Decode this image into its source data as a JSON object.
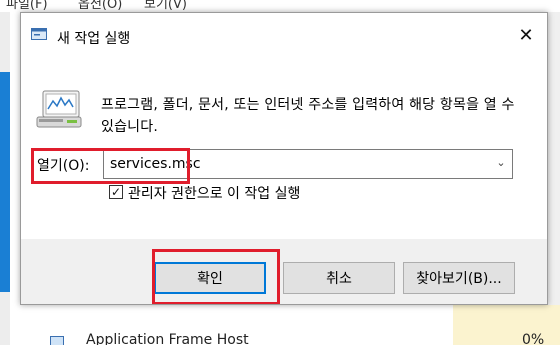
{
  "background": {
    "menu_items": [
      "파일(F)",
      "옵션(O)",
      "보기(V)"
    ],
    "visible_row": {
      "name": "Application Frame Host",
      "cpu": "0%"
    }
  },
  "dialog": {
    "title": "새 작업 실행",
    "description": "프로그램, 폴더, 문서, 또는 인터넷 주소를 입력하여 해당 항목을 열 수 있습니다.",
    "open_label": "열기(O):",
    "open_value": "services.msc",
    "checkbox_label": "관리자 권한으로 이 작업 실행",
    "checkbox_checked": true,
    "buttons": {
      "ok": "확인",
      "cancel": "취소",
      "browse": "찾아보기(B)..."
    }
  },
  "colors": {
    "highlight": "#e01d2c",
    "accent": "#0078d7",
    "dialog_bg": "#f0f0f0"
  },
  "icons": {
    "title": "run-dialog-icon",
    "body": "run-program-icon",
    "close": "close-icon",
    "dropdown": "chevron-down-icon",
    "check": "checkmark-icon"
  }
}
